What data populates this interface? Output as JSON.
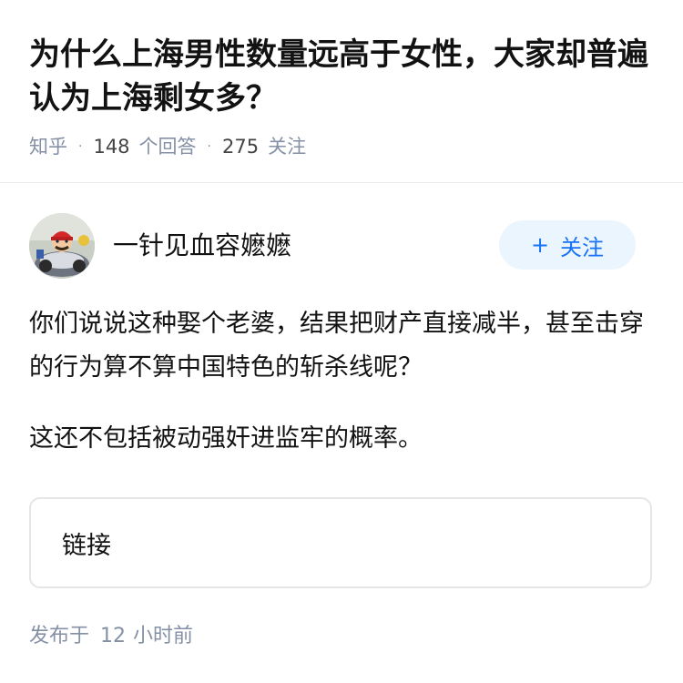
{
  "question": {
    "title": "为什么上海男性数量远高于女性，大家却普遍认为上海剩女多？",
    "source": "知乎",
    "answer_count": "148",
    "answer_label": "个回答",
    "follower_count": "275",
    "follower_label": "关注"
  },
  "author": {
    "name": "一针见血容嬷嬷",
    "follow_label": "关注",
    "follow_icon": "+"
  },
  "answer": {
    "paragraphs": [
      "你们说说这种娶个老婆，结果把财产直接减半，甚至击穿的行为算不算中国特色的斩杀线呢？",
      "这还不包括被动强奸进监牢的概率。"
    ]
  },
  "link_card": {
    "label": "链接"
  },
  "footer": {
    "published_prefix": "发布于",
    "published_num": "12",
    "published_suffix": "小时前"
  },
  "colors": {
    "primary": "#1772f6",
    "follow_bg": "#ebf5fd",
    "meta_gray": "#8590a6",
    "text": "#121212"
  }
}
